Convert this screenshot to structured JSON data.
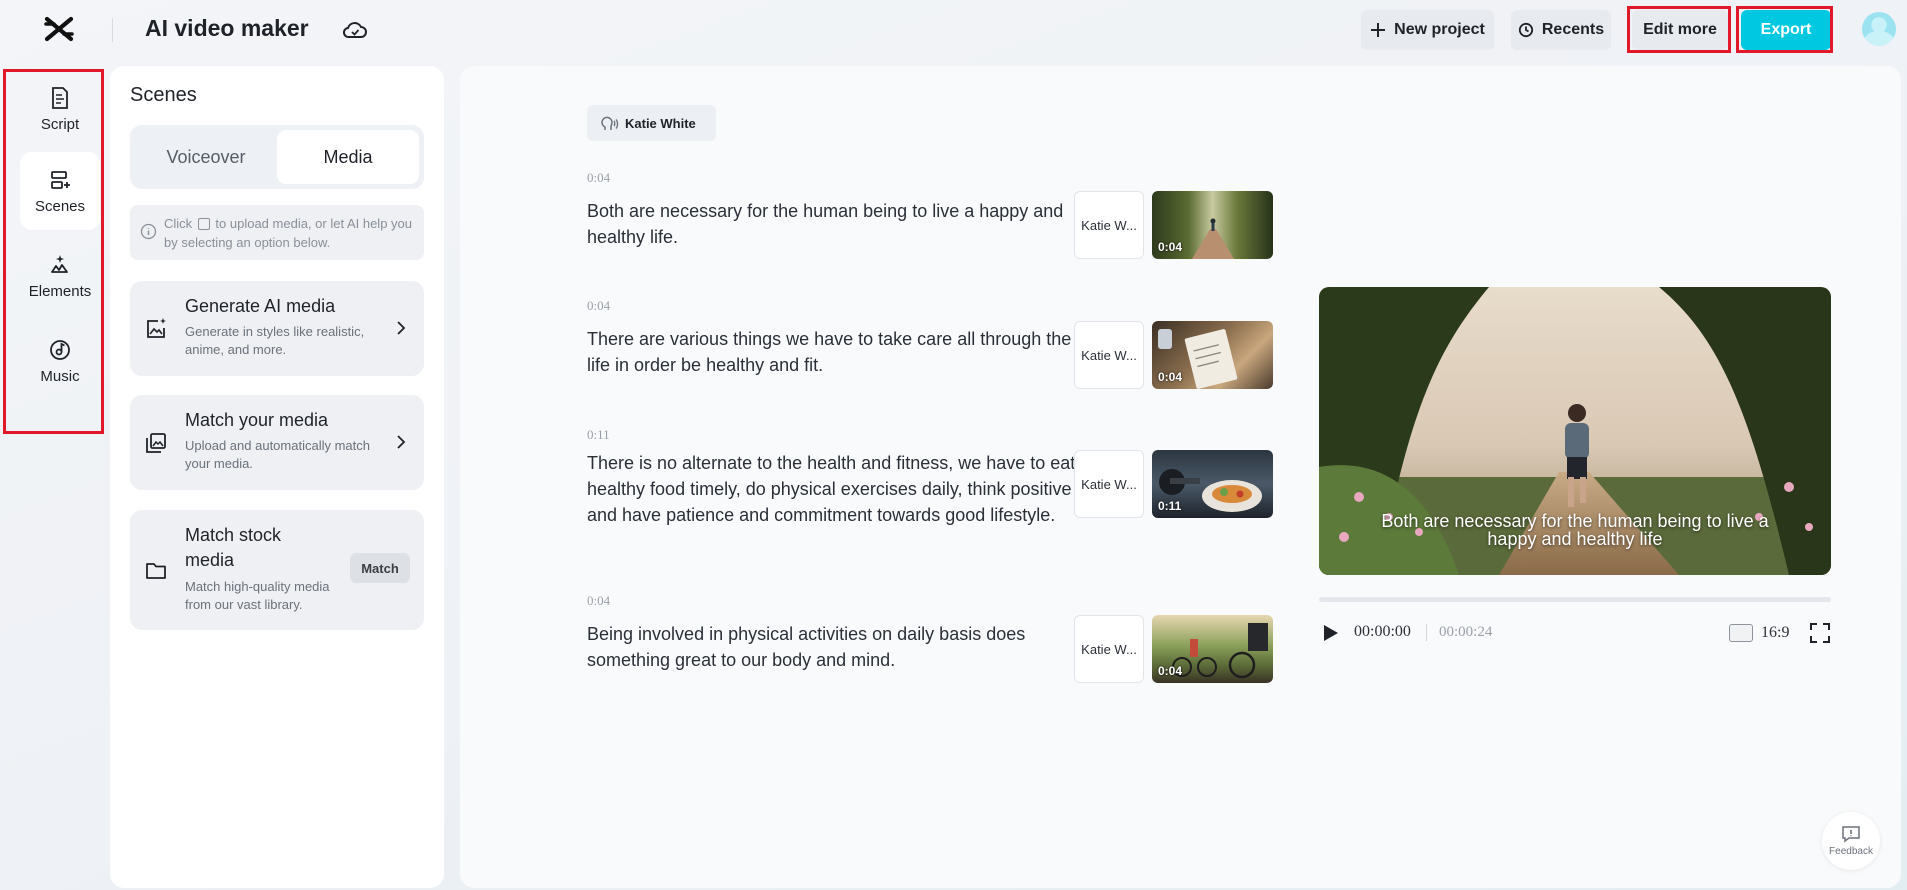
{
  "app": {
    "title": "AI video maker"
  },
  "toolbar": {
    "new_project": "New project",
    "recents": "Recents",
    "edit_more": "Edit more",
    "export": "Export"
  },
  "rail": {
    "items": [
      {
        "label": "Script",
        "icon": "script-icon",
        "active": false
      },
      {
        "label": "Scenes",
        "icon": "scenes-icon",
        "active": true
      },
      {
        "label": "Elements",
        "icon": "elements-icon",
        "active": false
      },
      {
        "label": "Music",
        "icon": "music-icon",
        "active": false
      }
    ]
  },
  "panel": {
    "title": "Scenes",
    "tabs": [
      {
        "label": "Voiceover",
        "active": false
      },
      {
        "label": "Media",
        "active": true
      }
    ],
    "hint_before": "Click",
    "hint_after": "to upload media, or let AI help you by selecting an option below.",
    "cards": [
      {
        "title": "Generate AI media",
        "desc": "Generate in styles like realistic, anime, and more.",
        "icon": "ai-image-icon"
      },
      {
        "title": "Match your media",
        "desc": "Upload and automatically match your media.",
        "icon": "gallery-icon"
      },
      {
        "title": "Match stock media",
        "desc": "Match high-quality media from our vast library.",
        "icon": "folder-icon",
        "button": "Match"
      }
    ]
  },
  "script": {
    "speaker": "Katie White",
    "scenes": [
      {
        "time": "0:04",
        "text": "Both are necessary for the human being to live a happy and healthy life.",
        "voice": "Katie W...",
        "duration": "0:04"
      },
      {
        "time": "0:04",
        "text": "There are various things we have to take care all through the life in order be healthy and fit.",
        "voice": "Katie W...",
        "duration": "0:04"
      },
      {
        "time": "0:11",
        "text": "There is no alternate to the health and fitness, we have to eat healthy food timely, do physical exercises daily, think positive and have patience and commitment towards good lifestyle.",
        "voice": "Katie W...",
        "duration": "0:11"
      },
      {
        "time": "0:04",
        "text": "Being involved in physical activities on daily basis does something great to our body and mind.",
        "voice": "Katie W...",
        "duration": "0:04"
      }
    ]
  },
  "preview": {
    "caption": "Both are necessary for the human being to live a happy and healthy life",
    "current_time": "00:00:00",
    "total_time": "00:00:24",
    "aspect_ratio": "16:9"
  },
  "feedback": {
    "label": "Feedback"
  },
  "colors": {
    "accent": "#00c8e0",
    "highlight": "#e0182a"
  }
}
